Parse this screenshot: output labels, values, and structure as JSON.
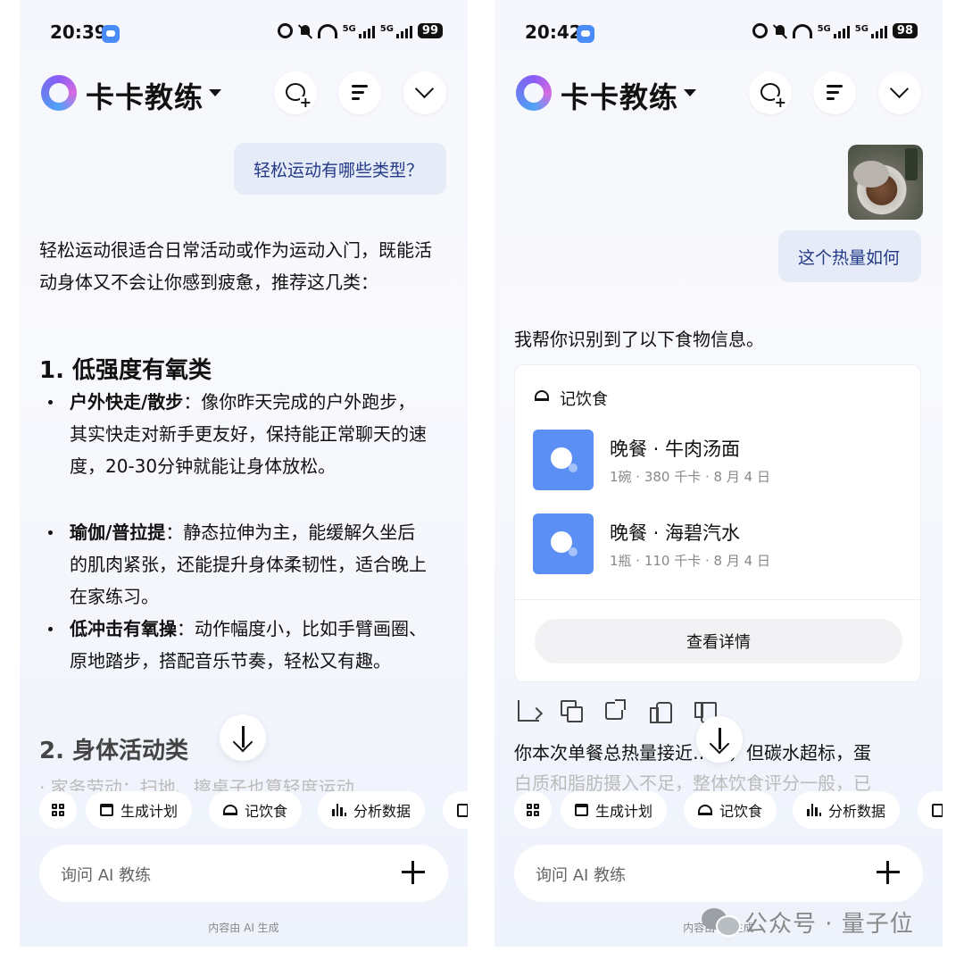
{
  "left": {
    "status": {
      "time": "20:39",
      "battery": "99",
      "net1": "5G",
      "net2": "5G"
    },
    "header": {
      "app_title": "卡卡教练"
    },
    "user_message": "轻松运动有哪些类型？",
    "answer_intro": "轻松运动很适合日常活动或作为运动入门，既能活动身体又不会让你感到疲惫，推荐这几类：",
    "section1_heading": "1. 低强度有氧类",
    "bullets": [
      {
        "title": "户外快走/散步",
        "text": "：像你昨天完成的户外跑步，其实快走对新手更友好，保持能正常聊天的速度，20-30分钟就能让身体放松。"
      },
      {
        "title": "瑜伽/普拉提",
        "text": "：静态拉伸为主，能缓解久坐后的肌肉紧张，还能提升身体柔韧性，适合晚上在家练习。"
      },
      {
        "title": "低冲击有氧操",
        "text": "：动作幅度小，比如手臂画圈、原地踏步，搭配音乐节奏，轻松又有趣。"
      }
    ],
    "section2_heading": "2. 身体活动类",
    "faded_line": "· 家务劳动：扫地、擦桌子也算轻度运动",
    "chips": [
      "生成计划",
      "记饮食",
      "分析数据"
    ],
    "input_placeholder": "询问 AI 教练",
    "ai_note": "内容由 AI 生成"
  },
  "right": {
    "status": {
      "time": "20:42",
      "battery": "98",
      "net1": "5G",
      "net2": "5G"
    },
    "header": {
      "app_title": "卡卡教练"
    },
    "user_message": "这个热量如何",
    "assistant_intro": "我帮你识别到了以下食物信息。",
    "card": {
      "title": "记饮食",
      "items": [
        {
          "name": "晚餐 · 牛肉汤面",
          "meta": "1碗 · 380 千卡 · 8 月 4 日"
        },
        {
          "name": "晚餐 · 海碧汽水",
          "meta": "1瓶 · 110 千卡 · 8 月 4 日"
        }
      ],
      "detail_button": "查看详情"
    },
    "para_line1": "你本次单餐总热量接近…标，但碳水超标，蛋",
    "para_line2": "白质和脂肪摄入不足，整体饮食评分一般，已",
    "chips": [
      "生成计划",
      "记饮食",
      "分析数据"
    ],
    "input_placeholder": "询问 AI 教练",
    "ai_note": "内容由 AI 生成"
  },
  "watermark": {
    "text": "公众号 · 量子位"
  },
  "colors": {
    "accent": "#5b8ff4",
    "user_bubble_bg": "#e6ebf8",
    "user_bubble_text": "#233a86"
  },
  "icons": [
    "new-chat-icon",
    "history-list-icon",
    "chevron-down-icon",
    "grid-icon",
    "calendar-icon",
    "cloche-icon",
    "bar-chart-icon",
    "document-icon",
    "plus-icon",
    "arrow-down-icon"
  ]
}
